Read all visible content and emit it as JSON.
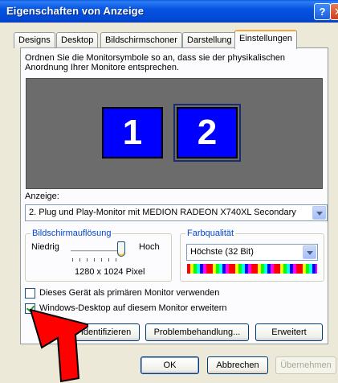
{
  "window": {
    "title": "Eigenschaften von Anzeige"
  },
  "tabs": [
    {
      "label": "Designs"
    },
    {
      "label": "Desktop"
    },
    {
      "label": "Bildschirmschoner"
    },
    {
      "label": "Darstellung"
    },
    {
      "label": "Einstellungen",
      "active": true
    }
  ],
  "settings": {
    "instruction": "Ordnen Sie die Monitorsymbole so an, dass sie der physikalischen Anordnung Ihrer Monitore entsprechen.",
    "monitors": [
      {
        "number": "1"
      },
      {
        "number": "2",
        "selected": true
      }
    ],
    "display_label": "Anzeige:",
    "display_value": "2. Plug und Play-Monitor mit MEDION RADEON X740XL Secondary",
    "resolution": {
      "legend": "Bildschirmauflösung",
      "low": "Niedrig",
      "high": "Hoch",
      "value": "1280 x 1024 Pixel",
      "level": 1.0
    },
    "color": {
      "legend": "Farbqualität",
      "value": "Höchste (32 Bit)"
    },
    "checkbox_primary": {
      "label": "Dieses Gerät als primären Monitor verwenden",
      "checked": false
    },
    "checkbox_extend": {
      "label": "Windows-Desktop auf diesem Monitor erweitern",
      "checked": true
    },
    "buttons": {
      "identify": "Identifizieren",
      "troubleshoot": "Problembehandlung...",
      "advanced": "Erweitert"
    }
  },
  "footer": {
    "ok": "OK",
    "cancel": "Abbrechen",
    "apply": "Übernehmen"
  },
  "colors": {
    "titlebar": "#0454e2",
    "monitor": "#0000fe",
    "annotation_arrow": "#ff0000"
  }
}
